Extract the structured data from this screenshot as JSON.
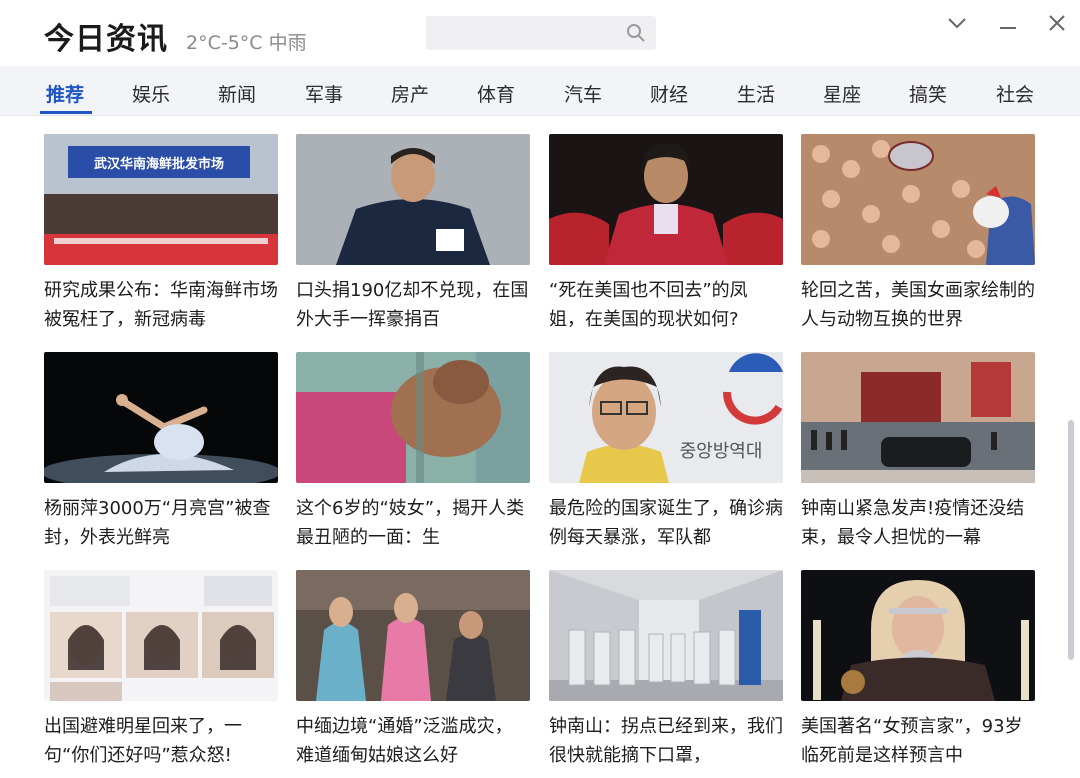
{
  "app": {
    "title": "今日资讯",
    "weather": "2°C-5°C 中雨"
  },
  "search": {
    "placeholder": ""
  },
  "window_controls": [
    "chevron-down-icon",
    "minimize-icon",
    "close-icon"
  ],
  "tabs": [
    {
      "label": "推荐",
      "active": true
    },
    {
      "label": "娱乐",
      "active": false
    },
    {
      "label": "新闻",
      "active": false
    },
    {
      "label": "军事",
      "active": false
    },
    {
      "label": "房产",
      "active": false
    },
    {
      "label": "体育",
      "active": false
    },
    {
      "label": "汽车",
      "active": false
    },
    {
      "label": "财经",
      "active": false
    },
    {
      "label": "生活",
      "active": false
    },
    {
      "label": "星座",
      "active": false
    },
    {
      "label": "搞笑",
      "active": false
    },
    {
      "label": "社会",
      "active": false
    }
  ],
  "articles": [
    {
      "title": "研究成果公布：华南海鲜市场被冤枉了，新冠病毒",
      "thumb_text": "武汉华南海鲜批发市场"
    },
    {
      "title": "口头捐190亿却不兑现，在国外大手一挥豪捐百",
      "thumb_text": ""
    },
    {
      "title": "“死在美国也不回去”的凤姐，在美国的现状如何?",
      "thumb_text": ""
    },
    {
      "title": "轮回之苦，美国女画家绘制的人与动物互换的世界",
      "thumb_text": ""
    },
    {
      "title": "杨丽萍3000万“月亮宫”被查封，外表光鲜亮",
      "thumb_text": ""
    },
    {
      "title": "这个6岁的“妓女”，揭开人类最丑陋的一面：生",
      "thumb_text": ""
    },
    {
      "title": "最危险的国家诞生了，确诊病例每天暴涨，军队都",
      "thumb_text": "중앙방역대"
    },
    {
      "title": "钟南山紧急发声!疫情还没结束，最令人担忧的一幕",
      "thumb_text": ""
    },
    {
      "title": "出国避难明星回来了，一句“你们还好吗”惹众怒!",
      "thumb_text": ""
    },
    {
      "title": "中缅边境“通婚”泛滥成灾，难道缅甸姑娘这么好",
      "thumb_text": ""
    },
    {
      "title": "钟南山：拐点已经到来，我们很快就能摘下口罩，",
      "thumb_text": ""
    },
    {
      "title": "美国著名“女预言家”，93岁临死前是这样预言中",
      "thumb_text": ""
    }
  ],
  "colors": {
    "accent": "#1f56c6",
    "tab_bg": "#f2f4f8"
  }
}
